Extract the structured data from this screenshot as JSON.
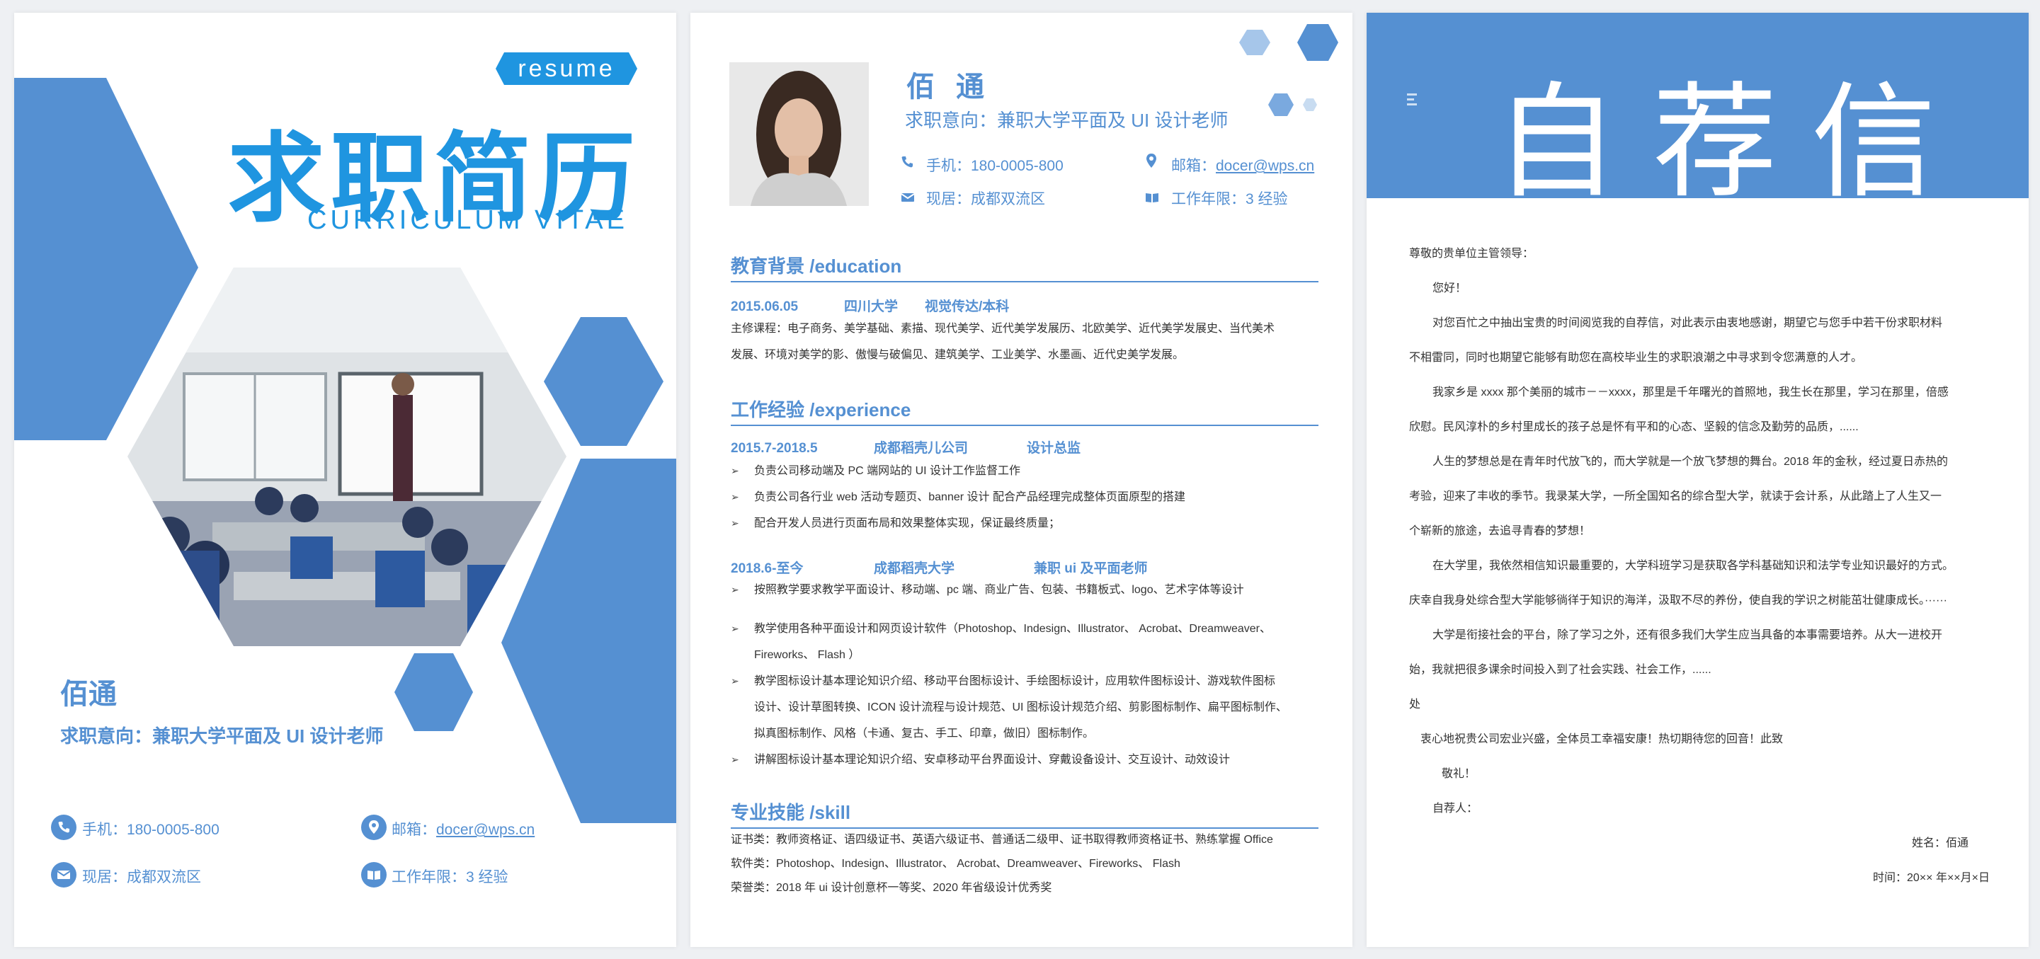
{
  "colors": {
    "accent": "#5590d2",
    "title_blue": "#1f95e0"
  },
  "cover": {
    "tag": "resume",
    "title": "求职简历",
    "subtitle": "CURRICULUM VITAE",
    "name": "佰通",
    "intent": "求职意向：兼职大学平面及 UI 设计老师",
    "phone": "手机：180-0005-800",
    "email_label": "邮箱：",
    "email": "docer@wps.cn",
    "location": "现居：成都双流区",
    "experience": "工作年限：3 经验"
  },
  "resume": {
    "name": "佰通",
    "intent": "求职意向：兼职大学平面及 UI 设计老师",
    "phone": "手机：180-0005-800",
    "email_label": "邮箱：",
    "email": "docer@wps.cn",
    "location": "现居：成都双流区",
    "experience": "工作年限：3 经验",
    "education": {
      "heading": "教育背景 /education",
      "date": "2015.06.05",
      "school": "四川大学",
      "major": "视觉传达/本科",
      "courses_1": "主修课程：电子商务、美学基础、素描、现代美学、近代美学发展历、北欧美学、近代美学发展史、当代美术",
      "courses_2": "发展、环境对美学的影、傲慢与破偏见、建筑美学、工业美学、水墨画、近代史美学发展。"
    },
    "experience_section": {
      "heading": "工作经验 /experience",
      "job1": {
        "date": "2015.7-2018.5",
        "company": "成都稻壳儿公司",
        "role": "设计总监",
        "bullets": [
          "负责公司移动端及 PC 端网站的 UI 设计工作监督工作",
          "负责公司各行业 web 活动专题页、banner 设计  配合产品经理完成整体页面原型的搭建",
          "配合开发人员进行页面布局和效果整体实现，保证最终质量；"
        ]
      },
      "job2": {
        "date": "2018.6-至今",
        "company": "成都稻壳大学",
        "role": "兼职 ui 及平面老师",
        "bullets": [
          "按照教学要求教学平面设计、移动端、pc 端、商业广告、包装、书籍板式、logo、艺术字体等设计",
          "教学使用各种平面设计和网页设计软件（Photoshop、Indesign、Illustrator、 Acrobat、Dreamweaver、",
          "Fireworks、 Flash ）",
          "教学图标设计基本理论知识介绍、移动平台图标设计、手绘图标设计，应用软件图标设计、游戏软件图标",
          "设计、设计草图转换、ICON 设计流程与设计规范、UI 图标设计规范介绍、剪影图标制作、扁平图标制作、",
          "拟真图标制作、风格（卡通、复古、手工、印章，做旧）图标制作。",
          "讲解图标设计基本理论知识介绍、安卓移动平台界面设计、穿戴设备设计、交互设计、动效设计"
        ]
      }
    },
    "skills": {
      "heading": "专业技能 /skill",
      "certs": "证书类：教师资格证、语四级证书、英语六级证书、普通话二级甲、证书取得教师资格证书、熟练掌握 Office",
      "software": "软件类：Photoshop、Indesign、Illustrator、 Acrobat、Dreamweaver、Fireworks、 Flash",
      "honors": "荣誉类：2018 年 ui 设计创意杯一等奖、2020 年省级设计优秀奖"
    }
  },
  "letter": {
    "title": "自荐信",
    "salutation": "尊敬的贵单位主管领导：",
    "greeting": "您好！",
    "lines": [
      "对您百忙之中抽出宝贵的时间阅览我的自荐信，对此表示由衷地感谢，期望它与您手中若干份求职材料",
      "不相雷同，同时也期望它能够有助您在高校毕业生的求职浪潮之中寻求到令您满意的人才。",
      "我家乡是 xxxx 那个美丽的城市－－xxxx，那里是千年曙光的首照地，我生长在那里，学习在那里，倍感",
      "欣慰。民风淳朴的乡村里成长的孩子总是怀有平和的心态、坚毅的信念及勤劳的品质，......",
      "人生的梦想总是在青年时代放飞的，而大学就是一个放飞梦想的舞台。2018 年的金秋，经过夏日赤热的",
      "考验，迎来了丰收的季节。我录某大学，一所全国知名的综合型大学，就读于会计系，从此踏上了人生又一",
      "个崭新的旅途，去追寻青春的梦想！",
      "在大学里，我依然相信知识最重要的，大学科班学习是获取各学科基础知识和法学专业知识最好的方式。",
      "庆幸自我身处综合型大学能够徜徉于知识的海洋，汲取不尽的养份，使自我的学识之树能茁壮健康成长。······",
      "大学是衔接社会的平台，除了学习之外，还有很多我们大学生应当具备的本事需要培养。从大一进校开",
      "始，我就把很多课余时间投入到了社会实践、社会工作，......",
      "处",
      "衷心地祝贵公司宏业兴盛，全体员工幸福安康！热切期待您的回音！此致",
      "敬礼！",
      "自荐人：",
      "姓名：佰通",
      "时间：20×× 年××月×日"
    ]
  }
}
